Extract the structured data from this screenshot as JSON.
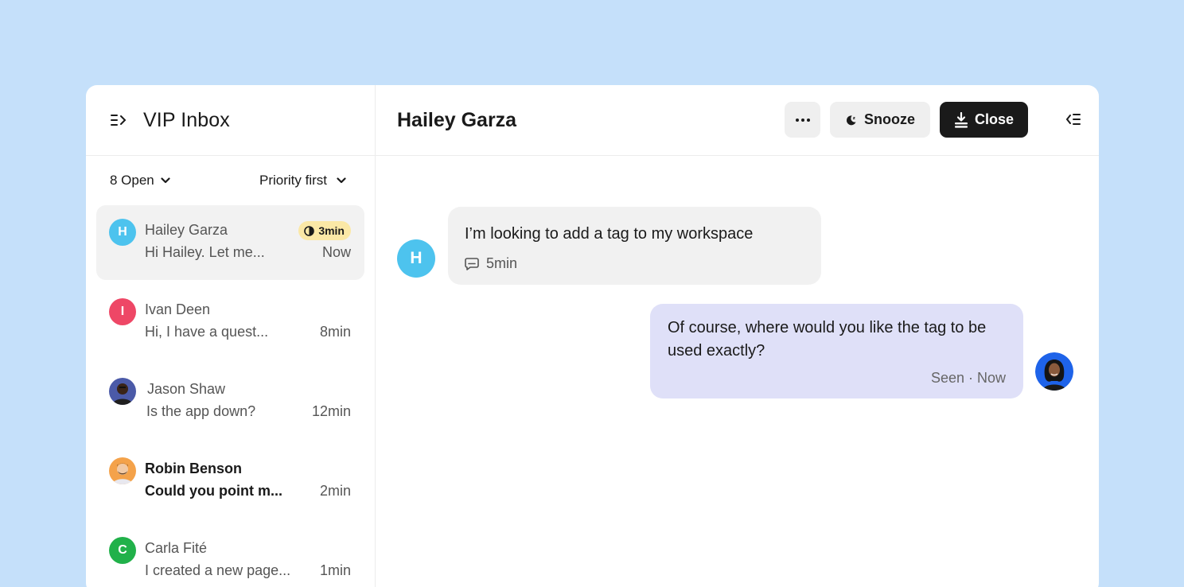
{
  "sidebar": {
    "title": "VIP Inbox",
    "open_filter": "8 Open",
    "sort_filter": "Priority first",
    "conversations": [
      {
        "initial": "H",
        "name": "Hailey Garza",
        "preview": "Hi Hailey. Let me...",
        "time": "Now",
        "sla": "3min",
        "color": "#4dc3ee"
      },
      {
        "initial": "I",
        "name": "Ivan Deen",
        "preview": "Hi, I have a quest...",
        "time": "8min",
        "color": "#ee4766"
      },
      {
        "initial": "",
        "name": "Jason Shaw",
        "preview": "Is the app down?",
        "time": "12min",
        "color": "#4b5aa8"
      },
      {
        "initial": "",
        "name": "Robin Benson",
        "preview": "Could you point m...",
        "time": "2min",
        "color": "#f4a24a"
      },
      {
        "initial": "C",
        "name": "Carla Fité",
        "preview": "I created a new page...",
        "time": "1min",
        "color": "#21b14a"
      }
    ]
  },
  "main": {
    "title": "Hailey Garza",
    "more_label": "•••",
    "snooze_label": "Snooze",
    "close_label": "Close"
  },
  "thread": {
    "incoming": {
      "avatar": "H",
      "text": "I’m looking to add a tag to my workspace",
      "meta": "5min"
    },
    "outgoing": {
      "text": "Of course, where would you like the tag to be used exactly?",
      "meta": "Seen · Now"
    }
  },
  "colors": {
    "background": "#c5e0fa",
    "badge": "#fbe8a6",
    "agent_bubble": "#dfe0f8",
    "primary_button": "#1a1a1a"
  }
}
